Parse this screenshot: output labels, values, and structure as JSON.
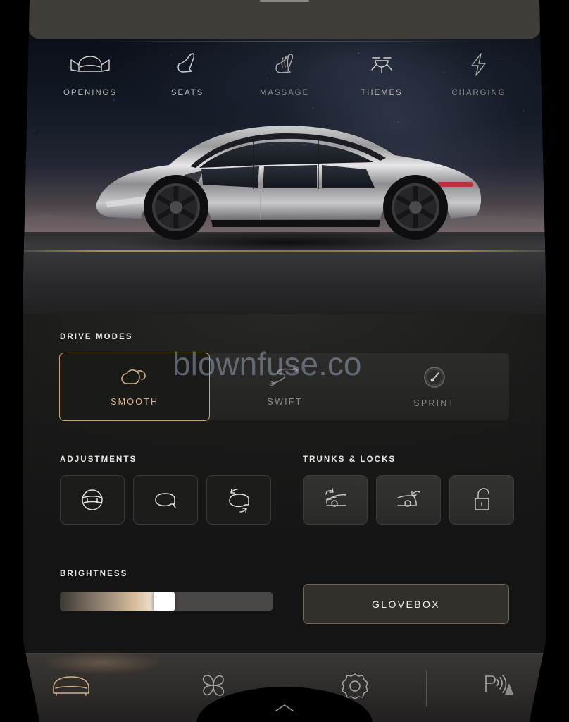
{
  "watermark": "blownfuse.co",
  "sheet": {
    "handle": "drag-handle"
  },
  "top_tabs": [
    {
      "label": "OPENINGS",
      "icon": "car-doors-open-icon"
    },
    {
      "label": "SEATS",
      "icon": "seat-icon"
    },
    {
      "label": "MASSAGE",
      "icon": "massage-seat-icon"
    },
    {
      "label": "THEMES",
      "icon": "dome-light-icon"
    },
    {
      "label": "CHARGING",
      "icon": "lightning-bolt-icon"
    }
  ],
  "hero": {
    "alt": "silver sedan on night highway"
  },
  "drive_modes": {
    "label": "DRIVE MODES",
    "selected": "SMOOTH",
    "options": [
      {
        "label": "SMOOTH",
        "icon": "cloud-icon",
        "selected": true
      },
      {
        "label": "SWIFT",
        "icon": "winding-road-icon",
        "selected": false
      },
      {
        "label": "SPRINT",
        "icon": "speedometer-icon",
        "selected": false
      }
    ]
  },
  "adjustments": {
    "label": "ADJUSTMENTS",
    "tiles": [
      {
        "icon": "steering-wheel-icon"
      },
      {
        "icon": "side-mirror-icon"
      },
      {
        "icon": "mirror-fold-icon"
      }
    ]
  },
  "trunks_locks": {
    "label": "TRUNKS & LOCKS",
    "tiles": [
      {
        "icon": "frunk-open-icon"
      },
      {
        "icon": "trunk-open-icon"
      },
      {
        "icon": "unlock-padlock-icon"
      }
    ]
  },
  "brightness": {
    "label": "BRIGHTNESS",
    "value": 49
  },
  "glovebox": {
    "label": "GLOVEBOX"
  },
  "bottom_nav": [
    {
      "icon": "car-front-icon",
      "active": true
    },
    {
      "icon": "fan-icon",
      "active": false
    },
    {
      "icon": "gear-icon",
      "active": false
    },
    {
      "icon": "park-assist-icon",
      "active": false
    }
  ],
  "notch": {
    "icon": "chevron-up-icon"
  },
  "colors": {
    "accent_gold": "#c9a678",
    "accent_gold_text": "#d9b485",
    "panel_dark": "#1a1a19",
    "tile_dark": "#1c1c1a",
    "tile_grey": "#333331",
    "text_primary": "#e9e7e4",
    "text_muted": "#8b8986",
    "slider_track": "#4a4744"
  }
}
